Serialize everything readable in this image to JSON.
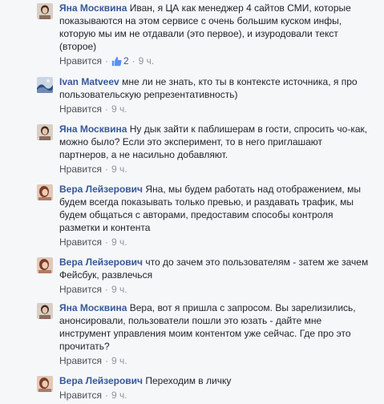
{
  "comments": [
    {
      "author": "Яна Москвина",
      "text": "Иван, я ЦА как менеджер 4 сайтов СМИ, которые показываются на этом сервисе с очень большим куском инфы, которую мы им не отдавали (это первое), и изуродовали текст (второе)",
      "like_label": "Нравится",
      "likes": "2",
      "time": "9 ч."
    },
    {
      "author": "Ivan Matveev",
      "text": "мне ли не знать, кто ты в контексте источника, я про пользовательскую репрезентативность)",
      "like_label": "Нравится",
      "time": "9 ч."
    },
    {
      "author": "Яна Москвина",
      "text": "Ну дык зайти к паблишерам в гости, спросить чо-как, можно было? Если это эксперимент, то в него приглашают партнеров, а не насильно добавляют.",
      "like_label": "Нравится",
      "time": "9 ч."
    },
    {
      "author": "Вера Лейзерович",
      "text": "Яна, мы будем работать над отображением, мы будем всегда показывать только превью, и раздавать трафик, мы будем общаться с авторами, предоставим способы контроля разметки и контента",
      "like_label": "Нравится",
      "time": "9 ч."
    },
    {
      "author": "Вера Лейзерович",
      "text": "что до зачем это пользователям - затем же зачем Фейсбук, развлечься",
      "like_label": "Нравится",
      "time": "9 ч."
    },
    {
      "author": "Яна Москвина",
      "text": "Вера, вот я пришла с запросом. Вы зарелизились, анонсировали, пользователи пошли это юзать - дайте мне инструмент управления моим контентом уже сейчас. Где про это прочитать?",
      "like_label": "Нравится",
      "time": "9 ч."
    },
    {
      "author": "Вера Лейзерович",
      "text": "Переходим в личку",
      "like_label": "Нравится",
      "time": "9 ч."
    }
  ],
  "colors": {
    "author": "#365899",
    "text": "#1d2129",
    "meta": "#90949c",
    "background": "#f6f7f9"
  },
  "icons": {
    "like_count": "thumbs-up-icon"
  }
}
